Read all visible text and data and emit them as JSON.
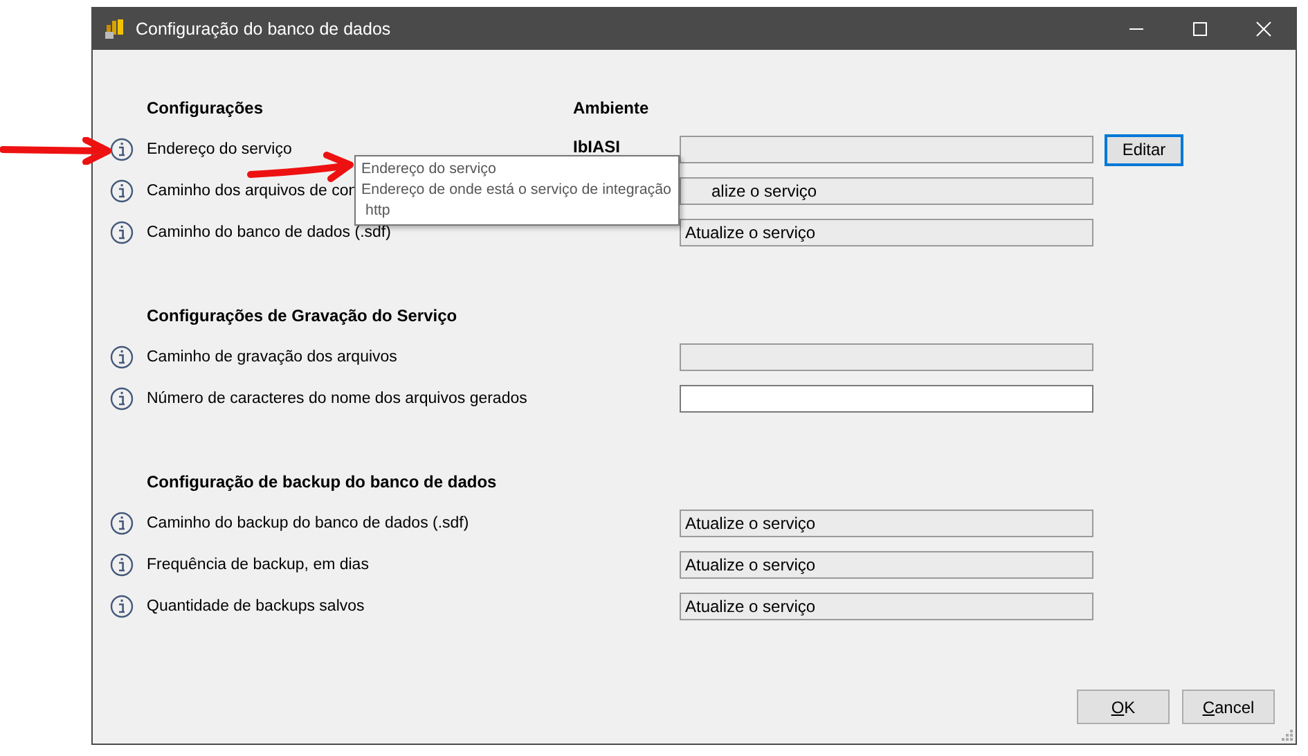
{
  "window": {
    "title": "Configuração do banco de dados"
  },
  "sections": [
    {
      "title": "Configurações",
      "column_header": "Ambiente",
      "environment": "IbIASI",
      "rows": [
        {
          "label": "Endereço do serviço",
          "value": "",
          "disabled": true,
          "action": "Editar"
        },
        {
          "label": "Caminho dos arquivos de con",
          "value": "alize o serviço",
          "disabled": true
        },
        {
          "label": "Caminho do banco de dados (.sdf)",
          "value": "Atualize o serviço",
          "disabled": true
        }
      ]
    },
    {
      "title": "Configurações de Gravação do Serviço",
      "rows": [
        {
          "label": "Caminho de gravação dos arquivos",
          "value": "",
          "disabled": true
        },
        {
          "label": "Número de caracteres do nome dos arquivos gerados",
          "value": "",
          "disabled": false
        }
      ]
    },
    {
      "title": "Configuração de backup do banco de dados",
      "rows": [
        {
          "label": "Caminho do backup do banco de dados (.sdf)",
          "value": "Atualize o serviço",
          "disabled": true
        },
        {
          "label": "Frequência de backup, em dias",
          "value": "Atualize o serviço",
          "disabled": true
        },
        {
          "label": "Quantidade de backups salvos",
          "value": "Atualize o serviço",
          "disabled": true
        }
      ]
    }
  ],
  "tooltip": {
    "title": "Endereço do serviço",
    "description": "Endereço de onde está o serviço de integração",
    "detail": "http"
  },
  "buttons": [
    {
      "label": "OK",
      "access_key_underlined": true
    },
    {
      "label": "Cancel",
      "access_key_underlined": true
    }
  ]
}
